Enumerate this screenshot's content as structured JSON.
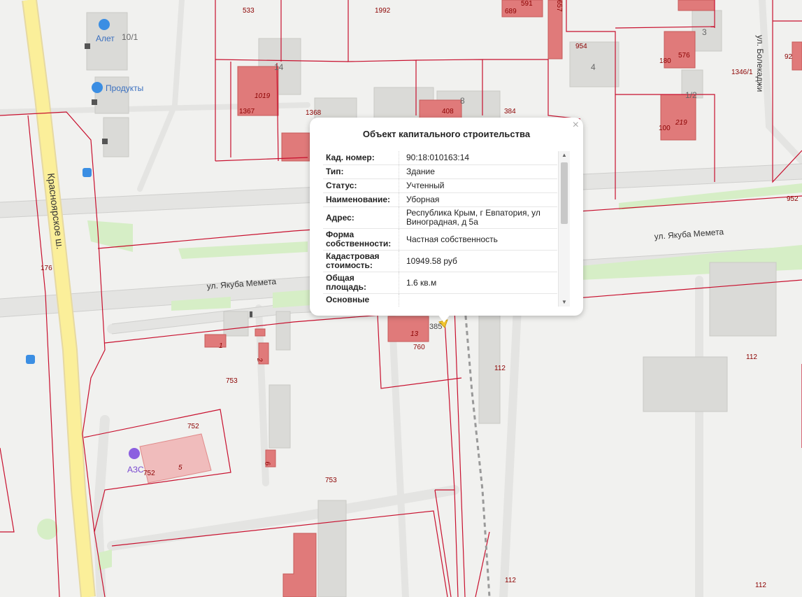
{
  "popup": {
    "title": "Объект капитального строительства",
    "close": "×",
    "rows": [
      {
        "key": "Кад. номер:",
        "value": "90:18:010163:14"
      },
      {
        "key": "Тип:",
        "value": "Здание"
      },
      {
        "key": "Статус:",
        "value": "Учтенный"
      },
      {
        "key": "Наименование:",
        "value": "Уборная"
      },
      {
        "key": "Адрес:",
        "value": "Республика Крым, г Евпатория, ул Виноградная, д 5а"
      },
      {
        "key": "Форма собственности:",
        "value": "Частная собственность"
      },
      {
        "key": "Кадастровая стоимость:",
        "value": "10949.58 руб"
      },
      {
        "key": "Общая площадь:",
        "value": "1.6 кв.м"
      },
      {
        "key": "Основные характеристики",
        "value": ""
      }
    ]
  },
  "map": {
    "streets": {
      "krasnoyarskoe": "Красноярское ш.",
      "yakuba_memeta_1": "ул. Якуба Мемета",
      "yakuba_memeta_2": "ул. Якуба Мемета",
      "bolekadzhi": "ул. Болекаджи"
    },
    "pois": {
      "alet": "Алет",
      "produkty": "Продукты",
      "azs": "АЗС"
    },
    "house_numbers": {
      "h10_1": "10/1",
      "h14": "14",
      "h8": "8",
      "h3": "3",
      "h4": "4",
      "h1_2": "1/2"
    },
    "parcels": {
      "p533": "533",
      "p1992": "1992",
      "p689": "689",
      "p591": "591",
      "p657": "657",
      "p954": "954",
      "p180": "180",
      "p576": "576",
      "p92": "92",
      "p1346_1": "1346/1",
      "p1019": "1019",
      "p1367": "1367",
      "p1368": "1368",
      "p408": "408",
      "p384": "384",
      "p100": "100",
      "p219": "219",
      "p952": "952",
      "p176": "176",
      "p1": "1",
      "p2": "2",
      "p753a": "753",
      "p752a": "752",
      "p5": "5",
      "p752b": "752",
      "p6": "6",
      "p753b": "753",
      "p13": "13",
      "p385": "385",
      "p760": "760",
      "p112a": "112",
      "p112b": "112",
      "p112c": "112",
      "p112d": "112",
      "p1_small": "1"
    }
  }
}
